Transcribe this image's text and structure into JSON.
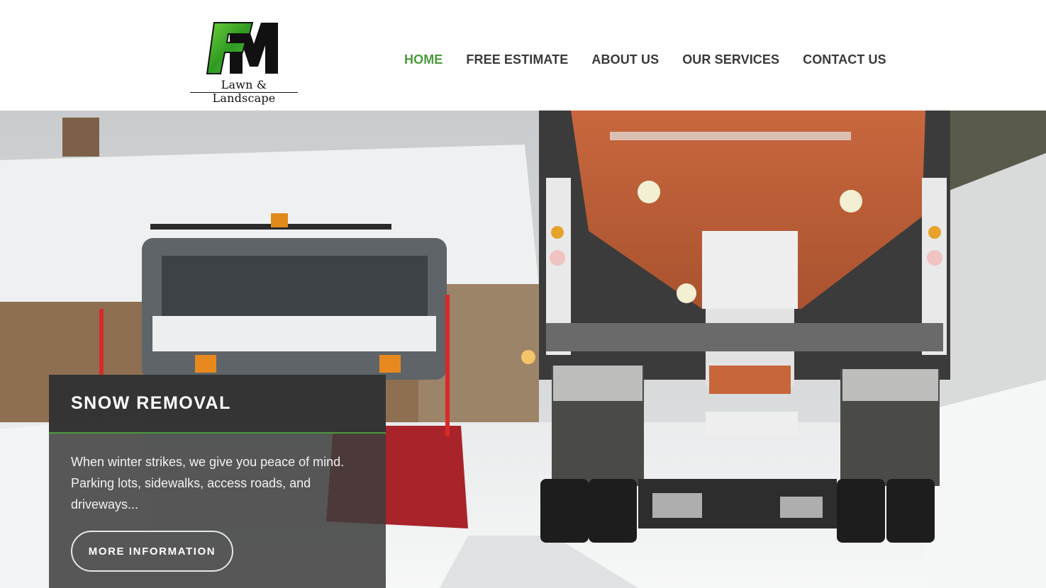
{
  "brand": {
    "logo_text": "Lawn & Landscape",
    "logo_icon": "fm-monogram-logo",
    "accent_color": "#4c9a3c"
  },
  "nav": {
    "items": [
      {
        "label": "HOME",
        "active": true
      },
      {
        "label": "FREE ESTIMATE",
        "active": false
      },
      {
        "label": "ABOUT US",
        "active": false
      },
      {
        "label": "OUR SERVICES",
        "active": false
      },
      {
        "label": "CONTACT US",
        "active": false
      }
    ]
  },
  "hero": {
    "image": "snow-plow-trucks-photo",
    "caption": {
      "title": "SNOW REMOVAL",
      "text": "When winter strikes, we give you peace of mind. Parking lots, sidewalks, access roads, and driveways...",
      "button_label": "MORE INFORMATION"
    }
  }
}
